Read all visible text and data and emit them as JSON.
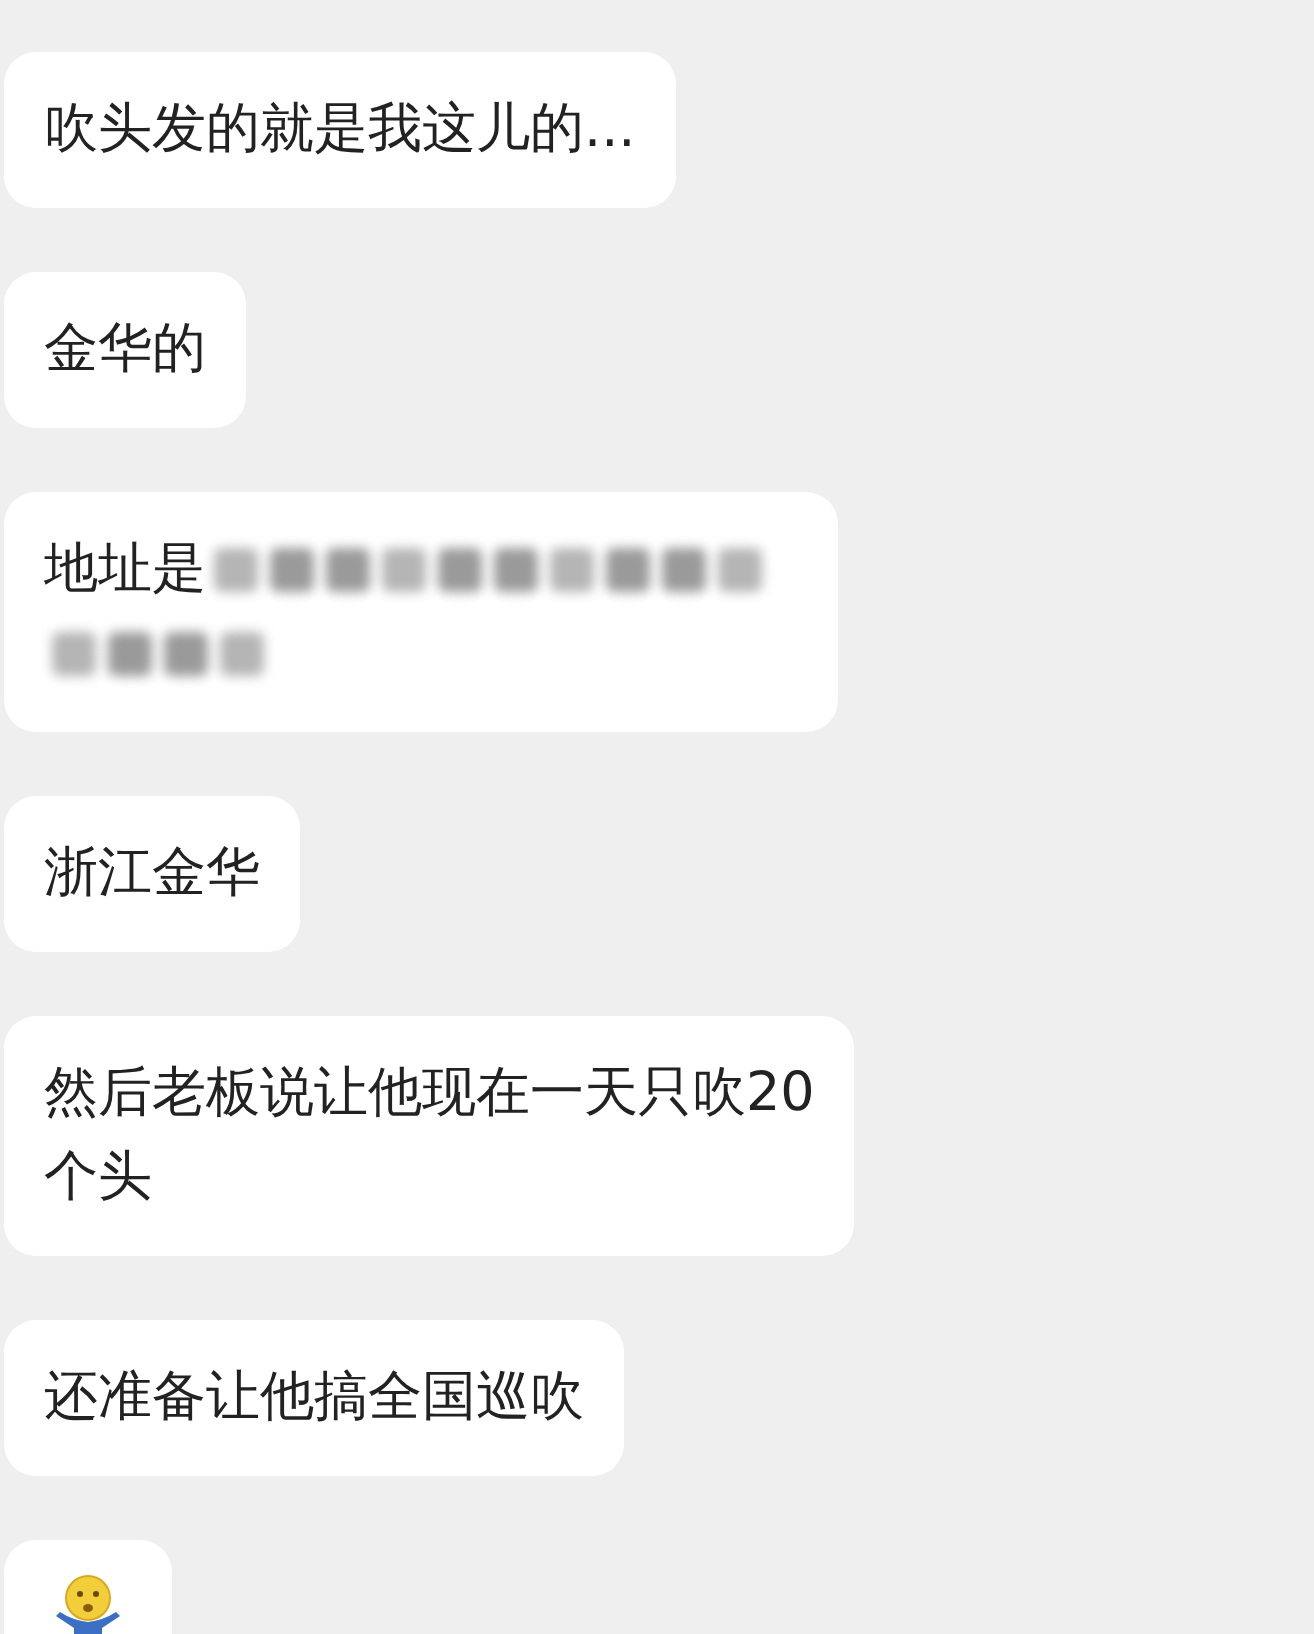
{
  "messages": [
    {
      "kind": "text",
      "lines": [
        "吹头发的就是我这儿的..."
      ]
    },
    {
      "kind": "text",
      "lines": [
        "金华的"
      ]
    },
    {
      "kind": "redacted",
      "lines": [
        "地址是"
      ]
    },
    {
      "kind": "text",
      "lines": [
        "浙江金华"
      ]
    },
    {
      "kind": "text",
      "lines": [
        "然后老板说让他现在一天只吹20",
        "个头"
      ]
    },
    {
      "kind": "text",
      "lines": [
        "还准备让他搞全国巡吹"
      ]
    },
    {
      "kind": "emoji"
    }
  ]
}
